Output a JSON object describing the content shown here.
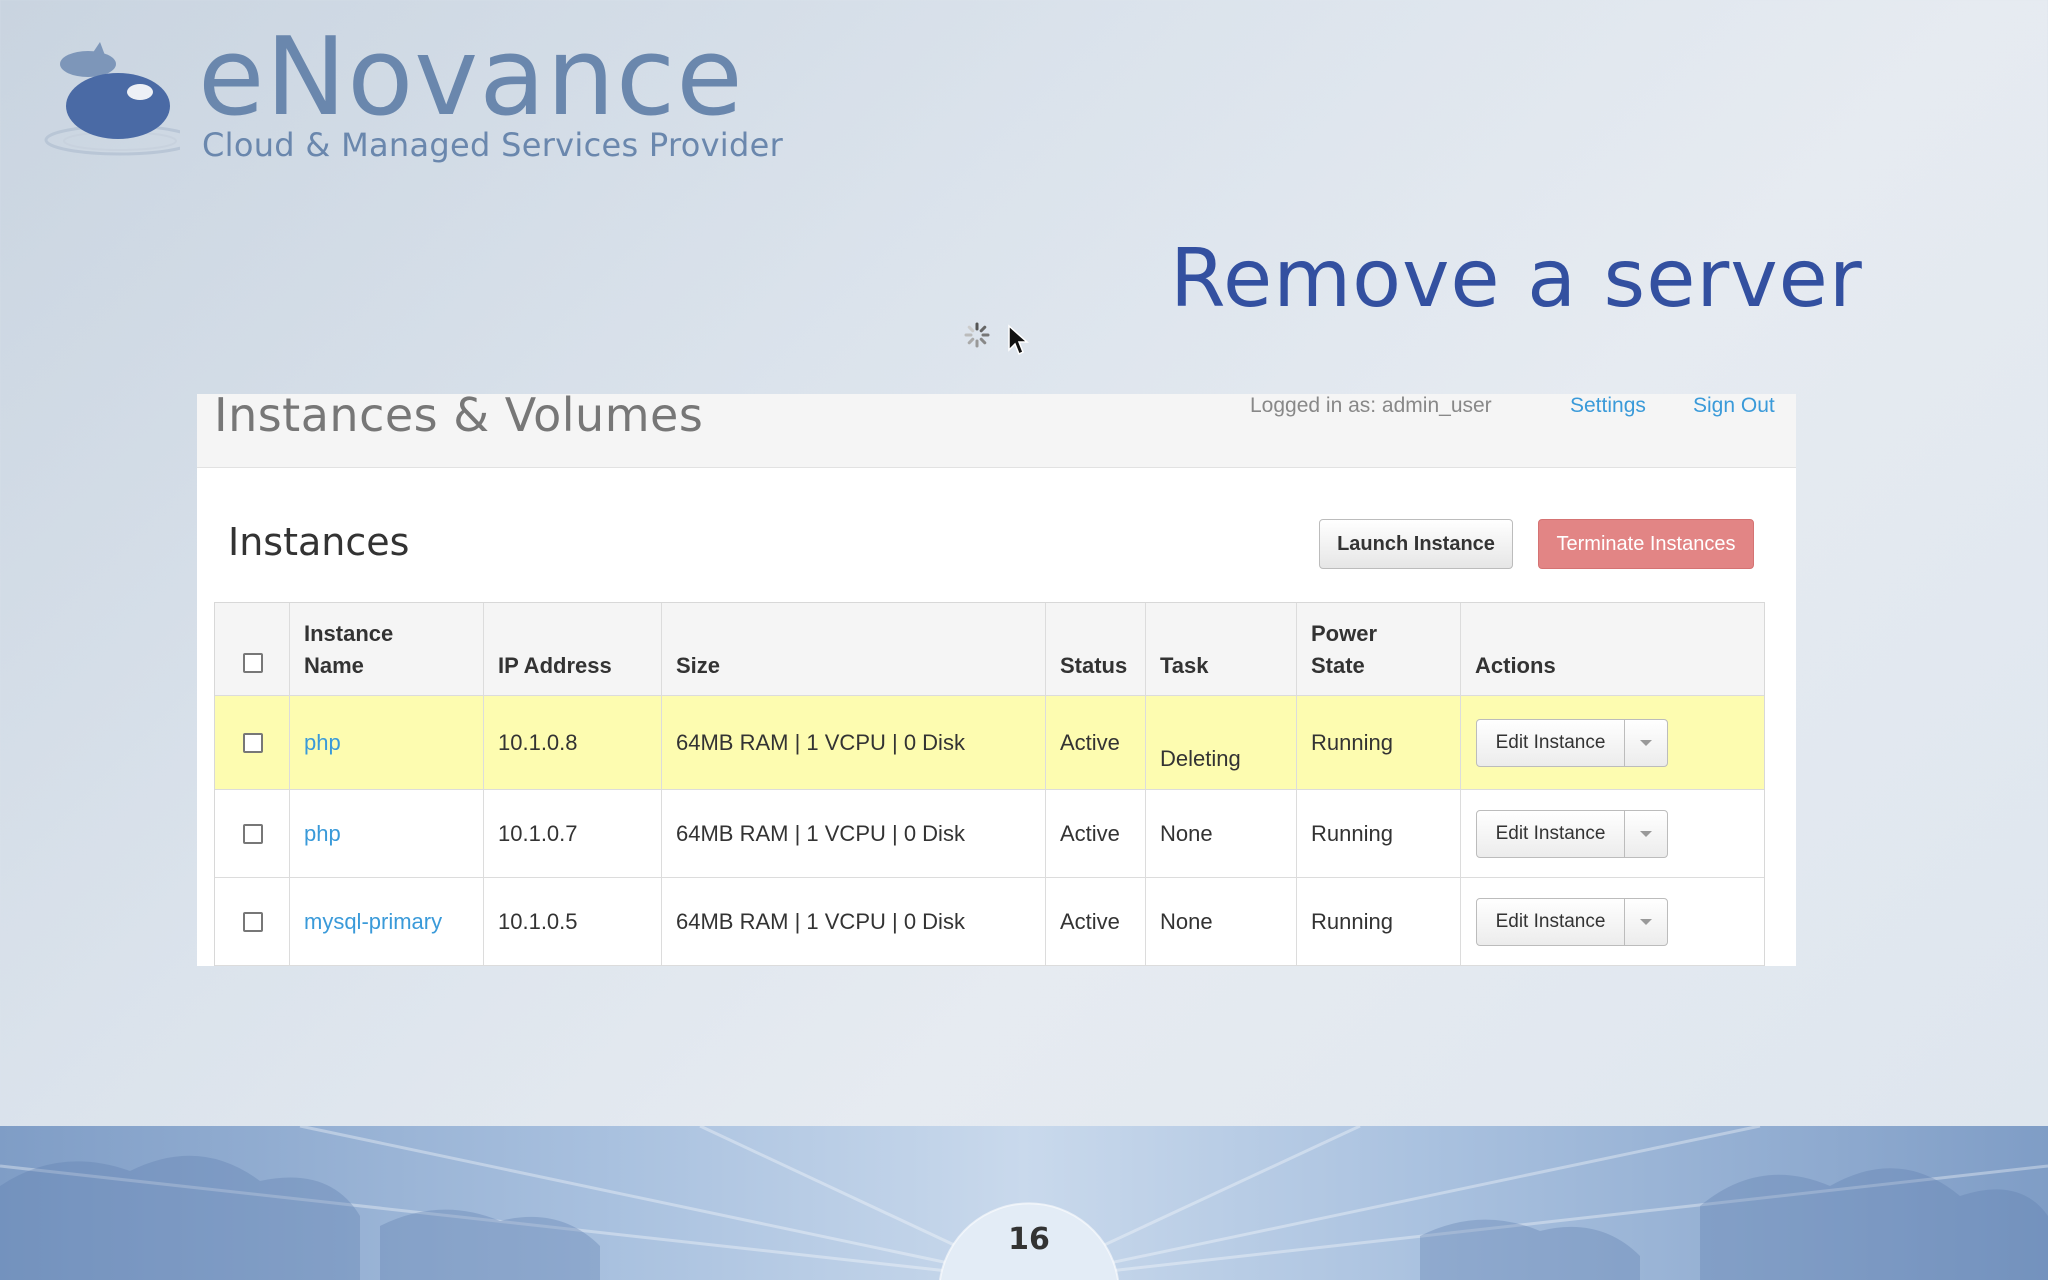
{
  "logo": {
    "wordmark": "eNovance",
    "tagline": "Cloud & Managed Services Provider"
  },
  "slide": {
    "title": "Remove a server",
    "page_number": "16"
  },
  "app": {
    "header_title": "Instances & Volumes",
    "logged_in": "Logged in as: admin_user",
    "settings_label": "Settings",
    "signout_label": "Sign Out",
    "section_title": "Instances",
    "launch_label": "Launch Instance",
    "terminate_label": "Terminate Instances",
    "colors": {
      "link": "#3a9ad9",
      "danger": "#e28585",
      "row_highlight": "#fdfcb0",
      "title_blue": "#3350a0",
      "logo_blue": "#6a87ad"
    }
  },
  "table": {
    "headers": {
      "name_line1": "Instance",
      "name_line2": "Name",
      "ip": "IP Address",
      "size": "Size",
      "status": "Status",
      "task": "Task",
      "power_line1": "Power",
      "power_line2": "State",
      "actions": "Actions"
    },
    "rows": [
      {
        "name": "php",
        "ip": "10.1.0.8",
        "size": "64MB RAM | 1 VCPU | 0 Disk",
        "status": "Active",
        "task": "Deleting",
        "power": "Running",
        "action": "Edit Instance"
      },
      {
        "name": "php",
        "ip": "10.1.0.7",
        "size": "64MB RAM | 1 VCPU | 0 Disk",
        "status": "Active",
        "task": "None",
        "power": "Running",
        "action": "Edit Instance"
      },
      {
        "name": "mysql-primary",
        "ip": "10.1.0.5",
        "size": "64MB RAM | 1 VCPU | 0 Disk",
        "status": "Active",
        "task": "None",
        "power": "Running",
        "action": "Edit Instance"
      }
    ]
  },
  "icons": {
    "logo_mark": "enovance-logo-icon",
    "spinner": "loading-spinner-icon",
    "pointer": "mouse-pointer-icon",
    "caret": "caret-down-icon"
  }
}
